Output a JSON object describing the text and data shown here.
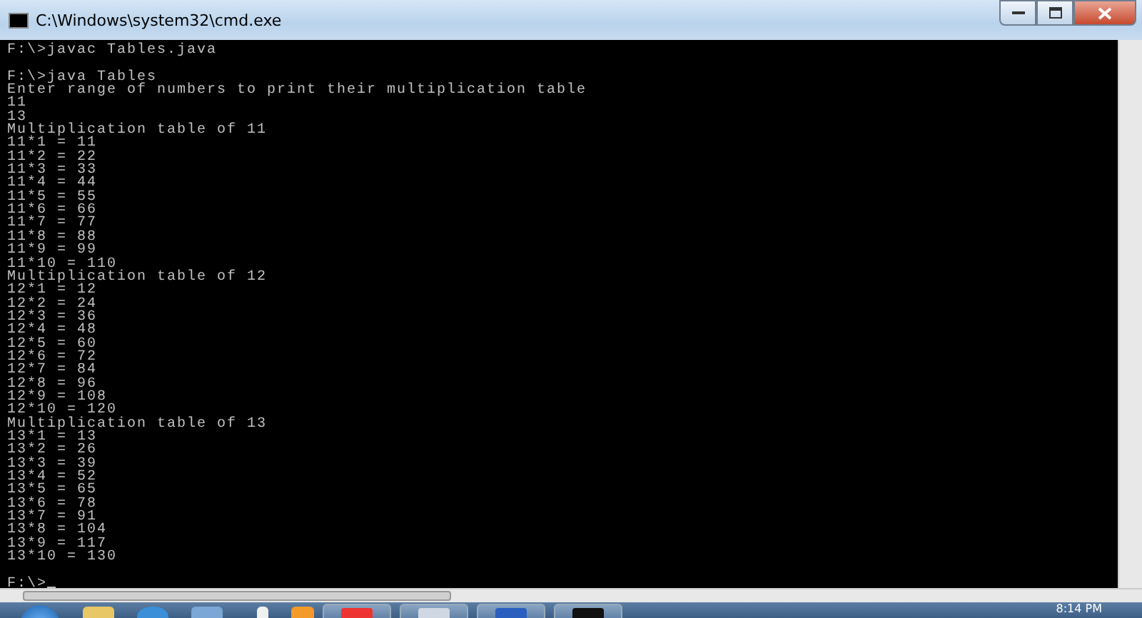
{
  "window": {
    "title": "C:\\Windows\\system32\\cmd.exe"
  },
  "console": {
    "lines": [
      {
        "text": "F:\\>javac Tables.java",
        "gap_before": false
      },
      {
        "text": "F:\\>java Tables",
        "gap_before": true
      },
      {
        "text": "Enter range of numbers to print their multiplication table",
        "gap_before": false
      },
      {
        "text": "11",
        "gap_before": false
      },
      {
        "text": "13",
        "gap_before": false
      },
      {
        "text": "Multiplication table of 11",
        "gap_before": false
      },
      {
        "text": "11*1 = 11",
        "gap_before": false
      },
      {
        "text": "11*2 = 22",
        "gap_before": false
      },
      {
        "text": "11*3 = 33",
        "gap_before": false
      },
      {
        "text": "11*4 = 44",
        "gap_before": false
      },
      {
        "text": "11*5 = 55",
        "gap_before": false
      },
      {
        "text": "11*6 = 66",
        "gap_before": false
      },
      {
        "text": "11*7 = 77",
        "gap_before": false
      },
      {
        "text": "11*8 = 88",
        "gap_before": false
      },
      {
        "text": "11*9 = 99",
        "gap_before": false
      },
      {
        "text": "11*10 = 110",
        "gap_before": false
      },
      {
        "text": "Multiplication table of 12",
        "gap_before": false
      },
      {
        "text": "12*1 = 12",
        "gap_before": false
      },
      {
        "text": "12*2 = 24",
        "gap_before": false
      },
      {
        "text": "12*3 = 36",
        "gap_before": false
      },
      {
        "text": "12*4 = 48",
        "gap_before": false
      },
      {
        "text": "12*5 = 60",
        "gap_before": false
      },
      {
        "text": "12*6 = 72",
        "gap_before": false
      },
      {
        "text": "12*7 = 84",
        "gap_before": false
      },
      {
        "text": "12*8 = 96",
        "gap_before": false
      },
      {
        "text": "12*9 = 108",
        "gap_before": false
      },
      {
        "text": "12*10 = 120",
        "gap_before": false
      },
      {
        "text": "Multiplication table of 13",
        "gap_before": false
      },
      {
        "text": "13*1 = 13",
        "gap_before": false
      },
      {
        "text": "13*2 = 26",
        "gap_before": false
      },
      {
        "text": "13*3 = 39",
        "gap_before": false
      },
      {
        "text": "13*4 = 52",
        "gap_before": false
      },
      {
        "text": "13*5 = 65",
        "gap_before": false
      },
      {
        "text": "13*6 = 78",
        "gap_before": false
      },
      {
        "text": "13*7 = 91",
        "gap_before": false
      },
      {
        "text": "13*8 = 104",
        "gap_before": false
      },
      {
        "text": "13*9 = 117",
        "gap_before": false
      },
      {
        "text": "13*10 = 130",
        "gap_before": false
      }
    ],
    "prompt": {
      "text": "F:\\>",
      "cursor": true
    }
  },
  "taskbar": {
    "clock": "8:14 PM"
  }
}
